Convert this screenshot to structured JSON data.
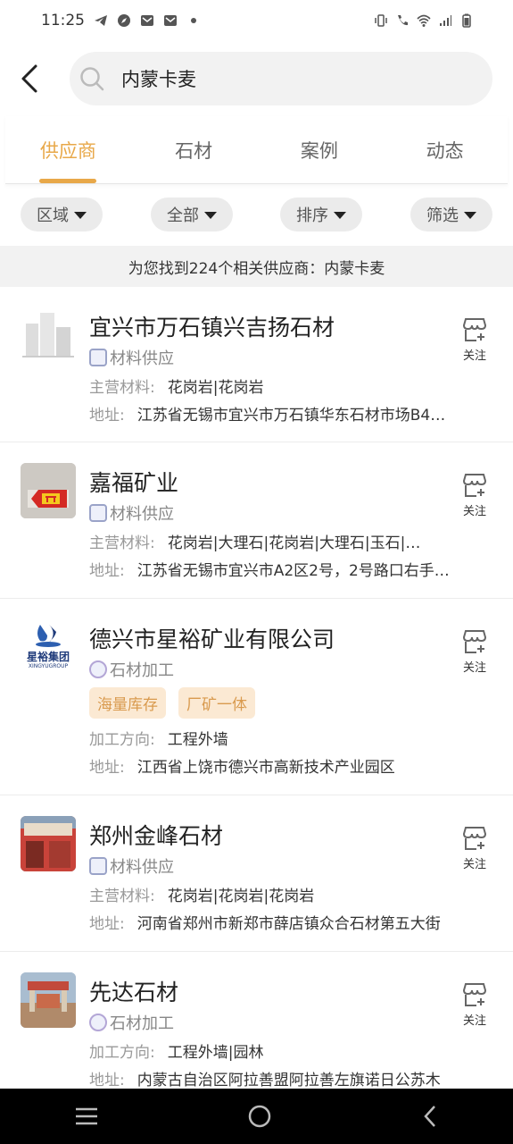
{
  "status_bar": {
    "time": "11:25"
  },
  "search": {
    "value": "内蒙卡麦"
  },
  "tabs": [
    {
      "label": "供应商"
    },
    {
      "label": "石材"
    },
    {
      "label": "案例"
    },
    {
      "label": "动态"
    }
  ],
  "filters": [
    {
      "label": "区域"
    },
    {
      "label": "全部"
    },
    {
      "label": "排序"
    },
    {
      "label": "筛选"
    }
  ],
  "result_text": "为您找到224个相关供应商：内蒙卡麦",
  "follow_label": "关注",
  "suppliers": [
    {
      "name": "宜兴市万石镇兴吉扬石材",
      "type": "材料供应",
      "row1_label": "主营材料:",
      "row1_value": "花岗岩|花岗岩",
      "addr_label": "地址:",
      "addr_value": "江苏省无锡市宜兴市万石镇华东石材市场B4…"
    },
    {
      "name": "嘉福矿业",
      "type": "材料供应",
      "row1_label": "主营材料:",
      "row1_value": "花岗岩|大理石|花岗岩|大理石|玉石|…",
      "addr_label": "地址:",
      "addr_value": "江苏省无锡市宜兴市A2区2号，2号路口右手…"
    },
    {
      "name": "德兴市星裕矿业有限公司",
      "type": "石材加工",
      "logo_text": "星裕集团",
      "logo_sub": "XINGYUGROUP",
      "tags": [
        "海量库存",
        "厂矿一体"
      ],
      "row1_label": "加工方向:",
      "row1_value": "工程外墙",
      "addr_label": "地址:",
      "addr_value": "江西省上饶市德兴市高新技术产业园区"
    },
    {
      "name": "郑州金峰石材",
      "type": "材料供应",
      "row1_label": "主营材料:",
      "row1_value": "花岗岩|花岗岩|花岗岩",
      "addr_label": "地址:",
      "addr_value": "河南省郑州市新郑市薛店镇众合石材第五大街"
    },
    {
      "name": "先达石材",
      "type": "石材加工",
      "row1_label": "加工方向:",
      "row1_value": "工程外墙|园林",
      "addr_label": "地址:",
      "addr_value": "内蒙古自治区阿拉善盟阿拉善左旗诺日公苏木"
    }
  ],
  "colors": {
    "accent": "#e8a849",
    "tag_bg": "#fbe9d3",
    "tag_text": "#d99a4e"
  }
}
